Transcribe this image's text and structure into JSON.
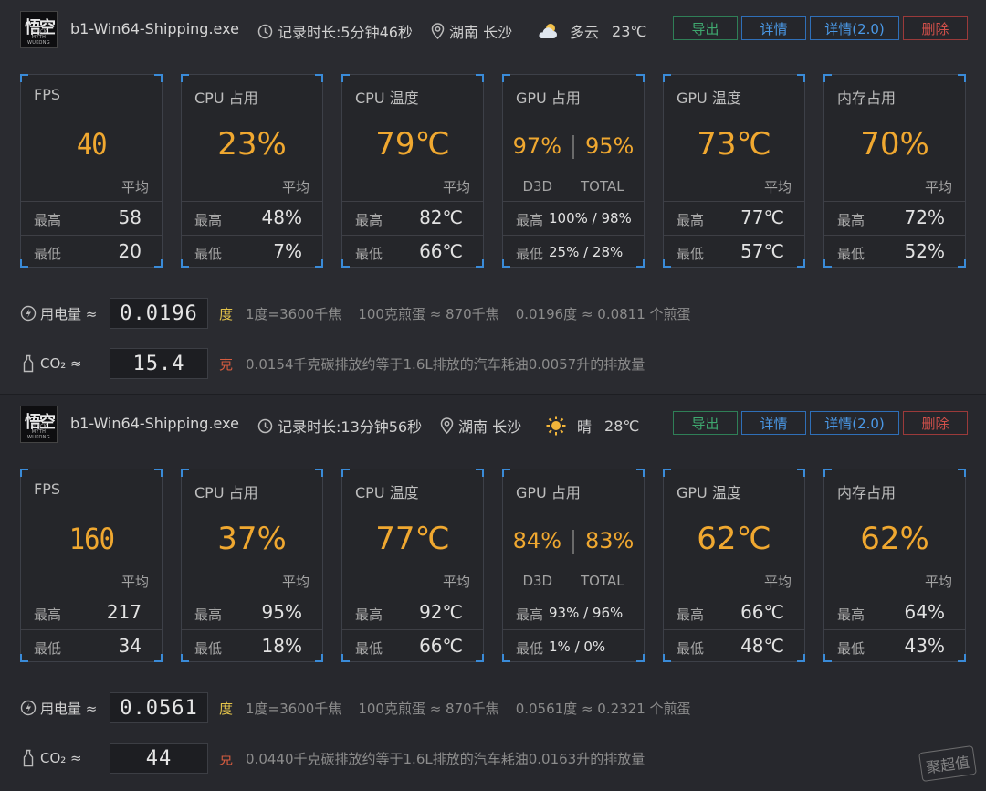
{
  "sessions": [
    {
      "exe": "b1-Win64-Shipping.exe",
      "duration": "记录时长:5分钟46秒",
      "location": "湖南 长沙",
      "weather": "多云",
      "temp": "23℃",
      "weather_icon": "cloudy-icon",
      "buttons": {
        "export": "导出",
        "detail": "详情",
        "detail2": "详情(2.0)",
        "delete": "删除"
      },
      "cards": {
        "fps": {
          "label": "FPS",
          "avg": "40",
          "avg_label": "平均",
          "max_label": "最高",
          "max": "58",
          "min_label": "最低",
          "min": "20"
        },
        "cpu_use": {
          "label": "CPU 占用",
          "avg": "23%",
          "avg_label": "平均",
          "max_label": "最高",
          "max": "48%",
          "min_label": "最低",
          "min": "7%"
        },
        "cpu_temp": {
          "label": "CPU 温度",
          "avg": "79℃",
          "avg_label": "平均",
          "max_label": "最高",
          "max": "82℃",
          "min_label": "最低",
          "min": "66℃"
        },
        "gpu_use": {
          "label": "GPU 占用",
          "d3d": "97%",
          "total": "95%",
          "d3d_label": "D3D",
          "total_label": "TOTAL",
          "max_label": "最高",
          "max": "100% / 98%",
          "min_label": "最低",
          "min": "25%  /  28%"
        },
        "gpu_temp": {
          "label": "GPU 温度",
          "avg": "73℃",
          "avg_label": "平均",
          "max_label": "最高",
          "max": "77℃",
          "min_label": "最低",
          "min": "57℃"
        },
        "mem_use": {
          "label": "内存占用",
          "avg": "70%",
          "avg_label": "平均",
          "max_label": "最高",
          "max": "72%",
          "min_label": "最低",
          "min": "52%"
        }
      },
      "energy": {
        "label": "用电量 ≈",
        "value": "0.0196",
        "unit": "度",
        "t1": "1度=3600千焦",
        "t2": "100克煎蛋 ≈ 870千焦",
        "t3": "0.0196度 ≈ 0.0811 个煎蛋"
      },
      "co2": {
        "label": "CO₂ ≈",
        "value": "15.4",
        "unit": "克",
        "t1": "0.0154千克碳排放约等于1.6L排放的汽车耗油0.0057升的排放量"
      }
    },
    {
      "exe": "b1-Win64-Shipping.exe",
      "duration": "记录时长:13分钟56秒",
      "location": "湖南 长沙",
      "weather": "晴",
      "temp": "28℃",
      "weather_icon": "sunny-icon",
      "buttons": {
        "export": "导出",
        "detail": "详情",
        "detail2": "详情(2.0)",
        "delete": "删除"
      },
      "cards": {
        "fps": {
          "label": "FPS",
          "avg": "160",
          "avg_label": "平均",
          "max_label": "最高",
          "max": "217",
          "min_label": "最低",
          "min": "34"
        },
        "cpu_use": {
          "label": "CPU 占用",
          "avg": "37%",
          "avg_label": "平均",
          "max_label": "最高",
          "max": "95%",
          "min_label": "最低",
          "min": "18%"
        },
        "cpu_temp": {
          "label": "CPU 温度",
          "avg": "77℃",
          "avg_label": "平均",
          "max_label": "最高",
          "max": "92℃",
          "min_label": "最低",
          "min": "66℃"
        },
        "gpu_use": {
          "label": "GPU 占用",
          "d3d": "84%",
          "total": "83%",
          "d3d_label": "D3D",
          "total_label": "TOTAL",
          "max_label": "最高",
          "max": "93%  /  96%",
          "min_label": "最低",
          "min": "1%   /   0%"
        },
        "gpu_temp": {
          "label": "GPU 温度",
          "avg": "62℃",
          "avg_label": "平均",
          "max_label": "最高",
          "max": "66℃",
          "min_label": "最低",
          "min": "48℃"
        },
        "mem_use": {
          "label": "内存占用",
          "avg": "62%",
          "avg_label": "平均",
          "max_label": "最高",
          "max": "64%",
          "min_label": "最低",
          "min": "43%"
        }
      },
      "energy": {
        "label": "用电量 ≈",
        "value": "0.0561",
        "unit": "度",
        "t1": "1度=3600千焦",
        "t2": "100克煎蛋 ≈ 870千焦",
        "t3": "0.0561度 ≈ 0.2321 个煎蛋"
      },
      "co2": {
        "label": "CO₂ ≈",
        "value": "44",
        "unit": "克",
        "t1": "0.0440千克碳排放约等于1.6L排放的汽车耗油0.0163升的排放量"
      }
    }
  ],
  "logo": {
    "main": "悟空",
    "sub": "BLACK MYTH WUKONG"
  },
  "watermark": "聚超值",
  "colors": {
    "accent": "#f0a830",
    "corner": "#3a8bd8",
    "export": "#3fa86f",
    "detail": "#4a98e6",
    "delete": "#d2504a"
  }
}
